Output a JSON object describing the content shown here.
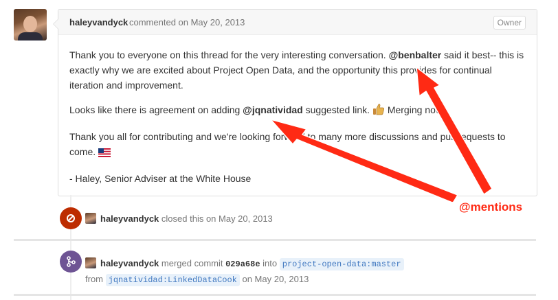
{
  "comment": {
    "author": "haleyvandyck",
    "meta": "commented on May 20, 2013",
    "badge": "Owner",
    "p1_a": "Thank you to everyone on this thread for the very interesting conversation.",
    "p1_mention": "@benbalter",
    "p1_b": "said it best-- this is exactly why we are excited about Project Open Data, and the opportunity this provides for continual iteration and improvement.",
    "p2_a": "Looks like there is agreement on adding",
    "p2_mention": "@jqnatividad",
    "p2_b": "suggested link.",
    "p2_c": "Merging now.",
    "p3_a": "Thank you all for contributing and we're looking forward to many more discussions and pull requests to come.",
    "p4": "- Haley, Senior Adviser at the White House"
  },
  "events": {
    "closed": {
      "author": "haleyvandyck",
      "text": "closed this on May 20, 2013"
    },
    "merged": {
      "author": "haleyvandyck",
      "text_a": "merged commit",
      "sha": "029a68e",
      "text_b": "into",
      "base_branch": "project-open-data:master",
      "text_c": "from",
      "head_branch": "jqnatividad:LinkedDataCook",
      "text_d": "on May 20, 2013"
    }
  },
  "annotation": {
    "label": "@mentions",
    "color": "#ff2a14"
  },
  "colors": {
    "closed_badge": "#bd2c00",
    "merged_badge": "#6e5494"
  },
  "icons": {
    "closed": "circle-slash-icon",
    "merged": "git-merge-icon",
    "thumbs_up": "thumbs-up-emoji",
    "flag": "us-flag-emoji"
  }
}
